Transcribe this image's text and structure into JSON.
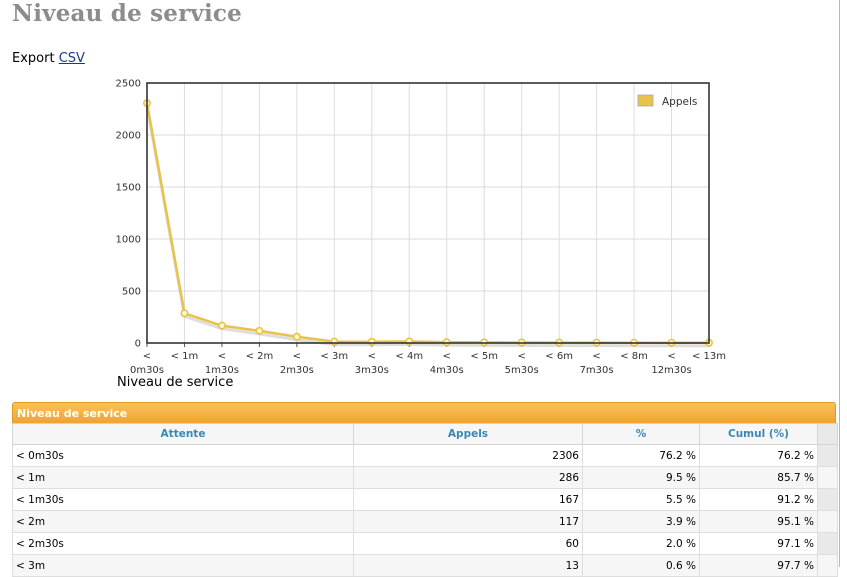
{
  "page": {
    "title": "Niveau de service"
  },
  "export": {
    "label": "Export",
    "link": "CSV"
  },
  "chart_data": {
    "type": "line",
    "title": "Niveau de service",
    "categories": [
      "< 0m30s",
      "< 1m",
      "< 1m30s",
      "< 2m",
      "< 2m30s",
      "< 3m",
      "< 3m30s",
      "< 4m",
      "< 4m30s",
      "< 5m",
      "< 5m30s",
      "< 6m",
      "< 7m30s",
      "< 8m",
      "< 12m30s",
      "< 13m"
    ],
    "tick_labels": [
      {
        "l1": "<",
        "l2": "0m30s"
      },
      {
        "l1": "< 1m",
        "l2": ""
      },
      {
        "l1": "<",
        "l2": "1m30s"
      },
      {
        "l1": "< 2m",
        "l2": ""
      },
      {
        "l1": "<",
        "l2": "2m30s"
      },
      {
        "l1": "< 3m",
        "l2": ""
      },
      {
        "l1": "<",
        "l2": "3m30s"
      },
      {
        "l1": "< 4m",
        "l2": ""
      },
      {
        "l1": "<",
        "l2": "4m30s"
      },
      {
        "l1": "< 5m",
        "l2": ""
      },
      {
        "l1": "<",
        "l2": "5m30s"
      },
      {
        "l1": "< 6m",
        "l2": ""
      },
      {
        "l1": "<",
        "l2": "7m30s"
      },
      {
        "l1": "< 8m",
        "l2": ""
      },
      {
        "l1": "<",
        "l2": "12m30s"
      },
      {
        "l1": "< 13m",
        "l2": ""
      }
    ],
    "series": [
      {
        "name": "Appels",
        "color": "#e8c24a",
        "values": [
          2306,
          286,
          167,
          117,
          60,
          13,
          12,
          15,
          8,
          6,
          5,
          4,
          4,
          3,
          3,
          2
        ]
      }
    ],
    "ylim": [
      0,
      2500
    ],
    "yticks": [
      0,
      500,
      1000,
      1500,
      2000,
      2500
    ],
    "grid": true,
    "legend": "top-right"
  },
  "table": {
    "title": "Niveau de service",
    "columns": [
      "Attente",
      "Appels",
      "%",
      "Cumul (%)"
    ],
    "rows": [
      [
        "< 0m30s",
        "2306",
        "76.2 %",
        "76.2 %"
      ],
      [
        "< 1m",
        "286",
        "9.5 %",
        "85.7 %"
      ],
      [
        "< 1m30s",
        "167",
        "5.5 %",
        "91.2 %"
      ],
      [
        "< 2m",
        "117",
        "3.9 %",
        "95.1 %"
      ],
      [
        "< 2m30s",
        "60",
        "2.0 %",
        "97.1 %"
      ],
      [
        "< 3m",
        "13",
        "0.6 %",
        "97.7 %"
      ]
    ]
  }
}
